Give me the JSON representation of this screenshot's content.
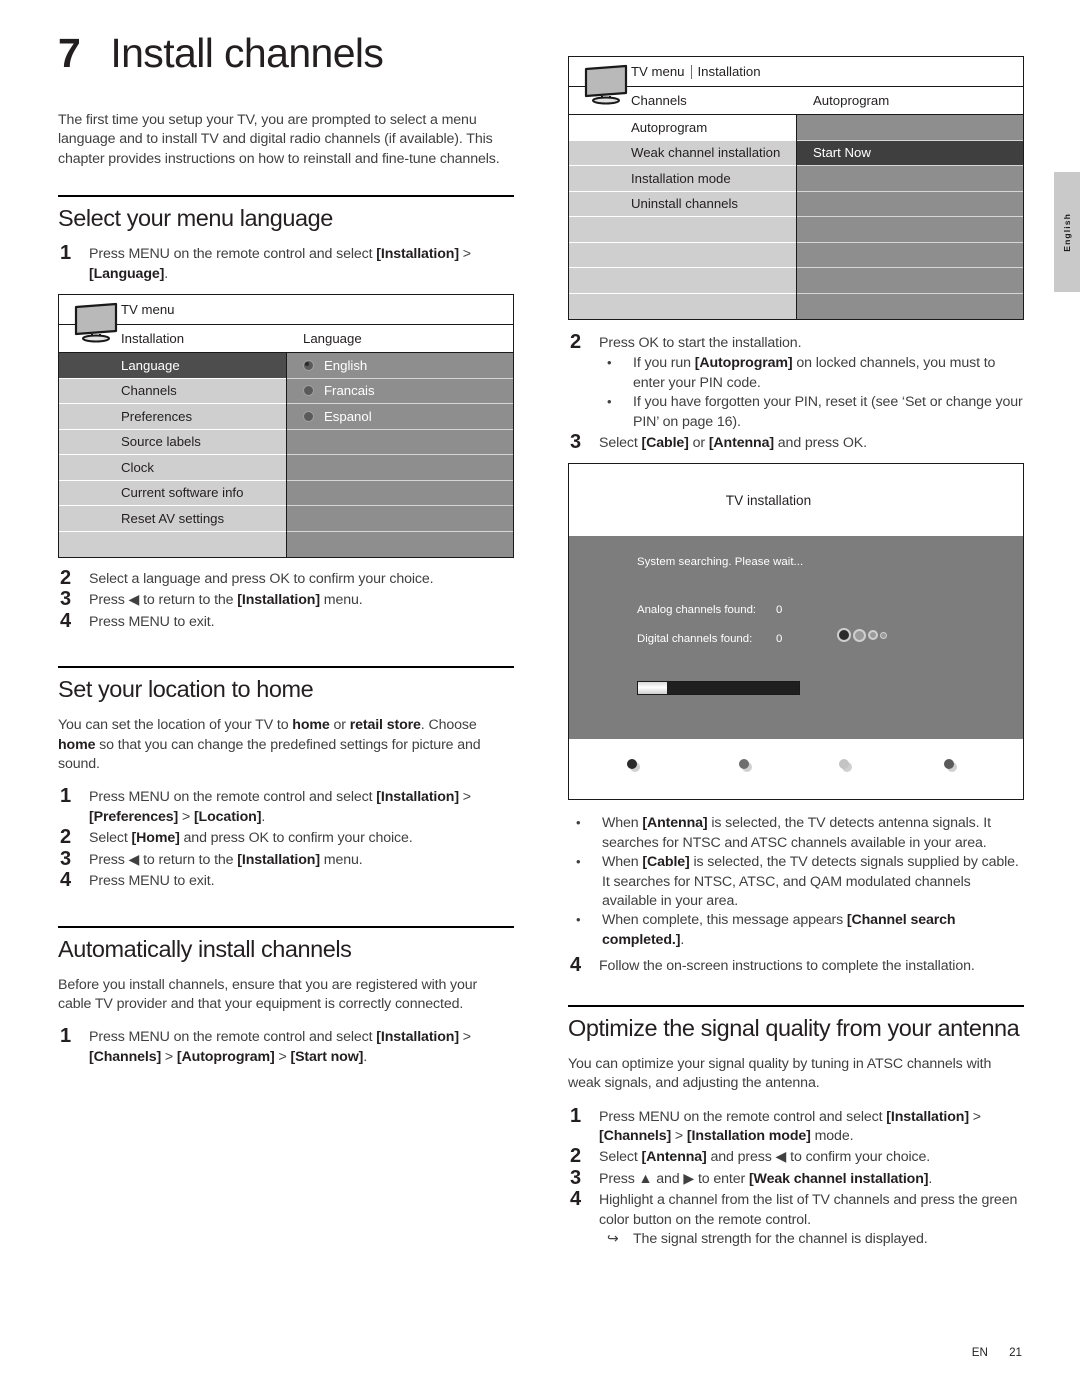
{
  "chapter": {
    "number": "7",
    "title": "Install channels"
  },
  "intro": "The first time you setup your TV, you are prompted to select a menu language and to install TV and digital radio channels (if available). This chapter provides instructions on how to reinstall and fine-tune channels.",
  "sections": {
    "menu_language": {
      "title": "Select your menu language",
      "step1_num": "1",
      "step1_text": "Press MENU on the remote control and select [Installation] > [Language].",
      "step2_num": "2",
      "step2_text": "Select a language and press OK to confirm your choice.",
      "step3_num": "3",
      "step3_text": "Press ◀ to return to the [Installation] menu.",
      "step4_num": "4",
      "step4_text": "Press MENU to exit."
    },
    "location_home": {
      "title": "Set your location to home",
      "body": "You can set the location of your TV to home or retail store. Choose home so that you can change the predefined settings for picture and sound.",
      "step1_num": "1",
      "step1_text": "Press MENU on the remote control and select [Installation] > [Preferences] > [Location].",
      "step2_num": "2",
      "step2_text": "Select [Home] and press OK to confirm your choice.",
      "step3_num": "3",
      "step3_text": "Press ◀ to return to the [Installation] menu.",
      "step4_num": "4",
      "step4_text": "Press MENU to exit."
    },
    "auto_install": {
      "title": "Automatically install channels",
      "body": "Before you install channels, ensure that you are registered with your cable TV provider and that your equipment is correctly connected.",
      "step1_num": "1",
      "step1_text": "Press MENU on the remote control and select [Installation] > [Channels] > [Autoprogram] > [Start now].",
      "step2_num": "2",
      "step2_text": "Press OK to start the installation.",
      "step2_bullets": [
        "If you run [Autoprogram] on locked channels, you must to enter your PIN code.",
        "If you have forgotten your PIN, reset it (see ‘Set or change your PIN’ on page 16)."
      ],
      "step3_num": "3",
      "step3_text": "Select [Cable] or [Antenna] and press OK.",
      "after_bullets": [
        "When [Antenna] is selected, the TV detects antenna signals. It searches for NTSC and ATSC channels available in your area.",
        "When [Cable] is selected, the TV detects signals supplied by cable. It searches for NTSC, ATSC, and QAM modulated channels available in your area.",
        "When complete, this message appears [Channel search completed.]."
      ],
      "step4_num": "4",
      "step4_text": "Follow the on-screen instructions to complete the installation."
    },
    "optimize_signal": {
      "title": "Optimize the signal quality from your antenna",
      "body": "You can optimize your signal quality by tuning in ATSC channels with weak signals, and adjusting the antenna.",
      "step1_num": "1",
      "step1_text": "Press MENU on the remote control and select [Installation] > [Channels] > [Installation mode] mode.",
      "step2_num": "2",
      "step2_text": "Select [Antenna] and press ◀ to confirm your choice.",
      "step3_num": "3",
      "step3_text": "Press ▲ and ▶ to enter [Weak channel installation].",
      "step4_num": "4",
      "step4_text": "Highlight a channel from the list of TV channels and press the green color button on the remote control.",
      "step4_result": "The signal strength for the channel is displayed."
    }
  },
  "tv_menu_language": {
    "titlebar": "TV menu",
    "col1_header": "Installation",
    "col2_header": "Language",
    "left_items": [
      {
        "label": "Language",
        "state": "selected"
      },
      {
        "label": "Channels",
        "state": "normal"
      },
      {
        "label": "Preferences",
        "state": "normal"
      },
      {
        "label": "Source labels",
        "state": "normal"
      },
      {
        "label": "Clock",
        "state": "normal"
      },
      {
        "label": "Current software info",
        "state": "normal"
      },
      {
        "label": "Reset AV settings",
        "state": "normal"
      },
      {
        "label": "",
        "state": "empty"
      }
    ],
    "right_items": [
      {
        "label": "English",
        "radio": true,
        "on": true
      },
      {
        "label": "Francais",
        "radio": true,
        "on": false
      },
      {
        "label": "Espanol",
        "radio": true,
        "on": false
      },
      {
        "label": "",
        "radio": false,
        "on": false
      },
      {
        "label": "",
        "radio": false,
        "on": false
      },
      {
        "label": "",
        "radio": false,
        "on": false
      },
      {
        "label": "",
        "radio": false,
        "on": false
      },
      {
        "label": "",
        "radio": false,
        "on": false
      }
    ]
  },
  "tv_menu_autoprogram": {
    "titlebar_1": "TV menu",
    "titlebar_2": "Installation",
    "col1_header": "Channels",
    "col2_header": "Autoprogram",
    "left_items": [
      {
        "label": "Autoprogram",
        "state": "white"
      },
      {
        "label": "Weak channel installation",
        "state": "normal"
      },
      {
        "label": "Installation mode",
        "state": "normal"
      },
      {
        "label": "Uninstall channels",
        "state": "normal"
      },
      {
        "label": "",
        "state": "empty"
      },
      {
        "label": "",
        "state": "empty"
      },
      {
        "label": "",
        "state": "empty"
      },
      {
        "label": "",
        "state": "empty"
      }
    ],
    "right_items": [
      {
        "label": "",
        "state": "empty"
      },
      {
        "label": "Start Now",
        "state": "selected"
      },
      {
        "label": "",
        "state": "empty"
      },
      {
        "label": "",
        "state": "empty"
      },
      {
        "label": "",
        "state": "empty"
      },
      {
        "label": "",
        "state": "empty"
      },
      {
        "label": "",
        "state": "empty"
      },
      {
        "label": "",
        "state": "empty"
      }
    ]
  },
  "tv_installation_dialog": {
    "title": "TV installation",
    "status": "System searching. Please wait...",
    "analog_label": "Analog channels found:",
    "analog_value": "0",
    "digital_label": "Digital channels found:",
    "digital_value": "0",
    "progress_percent": 18,
    "color_buttons": [
      "#2b2b2b",
      "#6e6e6e",
      "#c4c4c4",
      "#5a5a5a"
    ]
  },
  "side_tab": {
    "label": "English"
  },
  "footer": {
    "lang_code": "EN",
    "page": "21"
  },
  "colors": {
    "menu_row_bg": "#cfcfcf",
    "menu_row_selected": "#4d4d4d",
    "menu_right_bg": "#8e8e8e",
    "dialog_bg": "#7d7d7d",
    "text_body": "#404040"
  }
}
